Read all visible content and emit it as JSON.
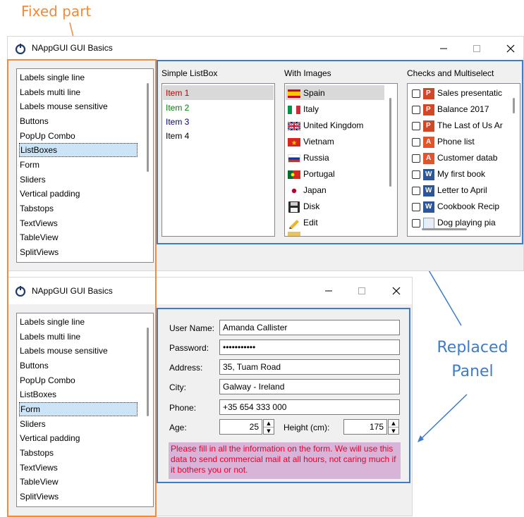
{
  "annotations": {
    "fixed_part": "Fixed part",
    "replaced_line1": "Replaced",
    "replaced_line2": "Panel"
  },
  "window": {
    "title": "NAppGUI GUI Basics"
  },
  "sidebar": {
    "items": [
      "Labels single line",
      "Labels multi line",
      "Labels mouse sensitive",
      "Buttons",
      "PopUp Combo",
      "ListBoxes",
      "Form",
      "Sliders",
      "Vertical padding",
      "Tabstops",
      "TextViews",
      "TableView",
      "SplitViews"
    ]
  },
  "top_window": {
    "selected_sidebar": "ListBoxes",
    "simple_listbox": {
      "header": "Simple ListBox",
      "items": [
        {
          "label": "Item 1",
          "color": "#c00000"
        },
        {
          "label": "Item 2",
          "color": "#008000"
        },
        {
          "label": "Item 3",
          "color": "#000080"
        },
        {
          "label": "Item 4",
          "color": "#000000"
        }
      ]
    },
    "images_listbox": {
      "header": "With Images",
      "items": [
        {
          "label": "Spain",
          "icon": "spain-flag-icon"
        },
        {
          "label": "Italy",
          "icon": "italy-flag-icon"
        },
        {
          "label": "United Kingdom",
          "icon": "uk-flag-icon"
        },
        {
          "label": "Vietnam",
          "icon": "vietnam-flag-icon"
        },
        {
          "label": "Russia",
          "icon": "russia-flag-icon"
        },
        {
          "label": "Portugal",
          "icon": "portugal-flag-icon"
        },
        {
          "label": "Japan",
          "icon": "japan-flag-icon"
        },
        {
          "label": "Disk",
          "icon": "disk-icon"
        },
        {
          "label": "Edit",
          "icon": "edit-icon"
        }
      ]
    },
    "checks_listbox": {
      "header": "Checks and Multiselect",
      "items": [
        {
          "label": "Sales presentatic",
          "icon": "powerpoint-icon"
        },
        {
          "label": "Balance 2017",
          "icon": "powerpoint-icon"
        },
        {
          "label": "The Last of Us Ar",
          "icon": "powerpoint-icon"
        },
        {
          "label": "Phone list",
          "icon": "access-icon"
        },
        {
          "label": "Customer datab",
          "icon": "access-icon"
        },
        {
          "label": "My first book",
          "icon": "word-icon"
        },
        {
          "label": "Letter to April",
          "icon": "word-icon"
        },
        {
          "label": "Cookbook Recip",
          "icon": "word-icon"
        },
        {
          "label": "Dog playing pia",
          "icon": "image-icon"
        }
      ]
    }
  },
  "bottom_window": {
    "selected_sidebar": "Form",
    "form": {
      "user_name_label": "User Name:",
      "user_name_value": "Amanda Callister",
      "password_label": "Password:",
      "password_value": "•••••••••••",
      "address_label": "Address:",
      "address_value": "35, Tuam Road",
      "city_label": "City:",
      "city_value": "Galway - Ireland",
      "phone_label": "Phone:",
      "phone_value": "+35 654 333 000",
      "age_label": "Age:",
      "age_value": "25",
      "height_label": "Height (cm):",
      "height_value": "175",
      "note": "Please fill in all the information on the form. We will use this data to send commercial mail at all hours, not caring much if it bothers you or not."
    }
  },
  "colors": {
    "orange": "#f08a3c",
    "blue": "#3d7cc8",
    "selection": "#cce4f7",
    "note_bg": "#d8b4d8",
    "note_text": "#e8002a"
  }
}
